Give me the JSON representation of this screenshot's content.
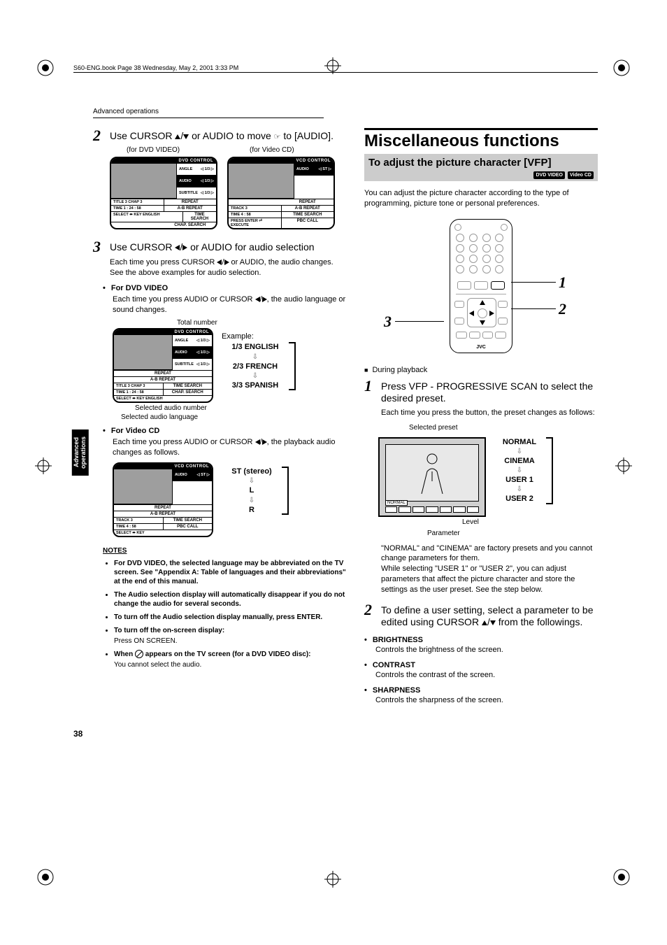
{
  "header_line": "S60-ENG.book  Page 38  Wednesday, May 2, 2001  3:33 PM",
  "running_head": "Advanced operations",
  "side_tab": "Advanced\noperations",
  "page_number": "38",
  "left": {
    "step2": {
      "num": "2",
      "text": "Use CURSOR 5/∞ or AUDIO to move       to [AUDIO].",
      "text_prefix": "Use CURSOR ",
      "text_mid": " or AUDIO to move ",
      "text_suffix": " to [AUDIO].",
      "cap_dvd": "(for DVD VIDEO)",
      "cap_vcd": "(for Video CD)"
    },
    "osd_dvd": {
      "title": "DVD CONTROL",
      "side": [
        {
          "l": "ANGLE",
          "v": "1/3"
        },
        {
          "l": "AUDIO",
          "v": "1/3"
        },
        {
          "l": "SUBTITLE",
          "v": "1/3"
        }
      ],
      "menu": [
        "REPEAT",
        "A-B REPEAT",
        "TIME SEARCH",
        "CHAP. SEARCH"
      ],
      "bottom_left_top": "TITLE 3   CHAP 3",
      "bottom_left_time": "TIME 1 : 24 : 58",
      "bottom_left_sel": "SELECT  ⬌ KEY   ENGLISH"
    },
    "osd_vcd": {
      "title": "VCD CONTROL",
      "side": [
        {
          "l": "AUDIO",
          "v": "ST"
        }
      ],
      "menu": [
        "REPEAT",
        "A-B REPEAT",
        "TIME SEARCH",
        "PBC CALL"
      ],
      "bottom_left_top": "TRACK 3",
      "bottom_left_time": "TIME     4 : 58",
      "bottom_left_sel": "PRESS ENTER ⏎ EXECUTE"
    },
    "step3": {
      "num": "3",
      "text_prefix": "Use CURSOR ",
      "text_suffix": " or AUDIO for audio selection",
      "body_line1": "Each time you press CURSOR 2/3 or AUDIO, the audio changes.",
      "body_line1_pre": "Each time you press CURSOR ",
      "body_line1_post": " or AUDIO, the audio changes.",
      "body_line2": "See the above examples for audio selection."
    },
    "dvd_sec": {
      "h": "For DVD VIDEO",
      "p_pre": "Each time you press AUDIO or CURSOR ",
      "p_post": ", the audio language or sound changes.",
      "total_number": "Total number",
      "selected_number": "Selected audio number",
      "selected_lang": "Selected audio language",
      "example": "Example:",
      "seq": [
        "1/3 ENGLISH",
        "2/3 FRENCH",
        "3/3 SPANISH"
      ]
    },
    "vcd_sec": {
      "h": "For Video CD",
      "p_pre": "Each time you press AUDIO or CURSOR ",
      "p_post": ", the playback audio changes as follows.",
      "seq": [
        "ST (stereo)",
        "L",
        "R"
      ]
    },
    "notes": {
      "h": "NOTES",
      "items": [
        {
          "b": "For DVD VIDEO, the selected language may be abbreviated on the TV screen.  See \"Appendix A: Table of languages and their abbreviations\" at the end of this manual."
        },
        {
          "b": "The Audio selection display will automatically disappear if you do not change the audio for several seconds."
        },
        {
          "b": "To turn off the Audio selection display manually, press ENTER."
        },
        {
          "b": "To turn off the on-screen display:",
          "sub": "Press ON SCREEN."
        },
        {
          "b_pre": "When ",
          "b_post": " appears on the TV screen (for a DVD VIDEO disc):",
          "sub": "You cannot select the audio."
        }
      ]
    }
  },
  "right": {
    "h1": "Miscellaneous functions",
    "subhead": "To adjust the picture character [VFP]",
    "badges": [
      "DVD VIDEO",
      "Video CD"
    ],
    "para1": "You can adjust the picture character according to the type of programming, picture tone or personal preferences.",
    "remote_callouts": [
      "1",
      "2",
      "3"
    ],
    "remote_brand": "JVC",
    "during": "During playback",
    "step1": {
      "num": "1",
      "text": "Press VFP - PROGRESSIVE SCAN to select the desired preset.",
      "body": "Each time you press the button, the preset changes as follows:"
    },
    "preset": {
      "selected": "Selected preset",
      "seq": [
        "NORMAL",
        "CINEMA",
        "USER 1",
        "USER 2"
      ],
      "level": "Level",
      "parameter": "Parameter"
    },
    "preset_note": "\"NORMAL\" and \"CINEMA\" are factory presets and you cannot change parameters for them.\nWhile selecting \"USER 1\" or \"USER 2\", you can adjust parameters that affect the picture character and store the settings as the user preset. See the step below.",
    "step2": {
      "num": "2",
      "text_pre": "To define a user setting, select a parameter to be edited using CURSOR ",
      "text_post": " from the followings."
    },
    "params": [
      {
        "h": "BRIGHTNESS",
        "d": "Controls the brightness of the screen."
      },
      {
        "h": "CONTRAST",
        "d": "Controls the contrast of the screen."
      },
      {
        "h": "SHARPNESS",
        "d": "Controls the sharpness of the screen."
      }
    ]
  }
}
